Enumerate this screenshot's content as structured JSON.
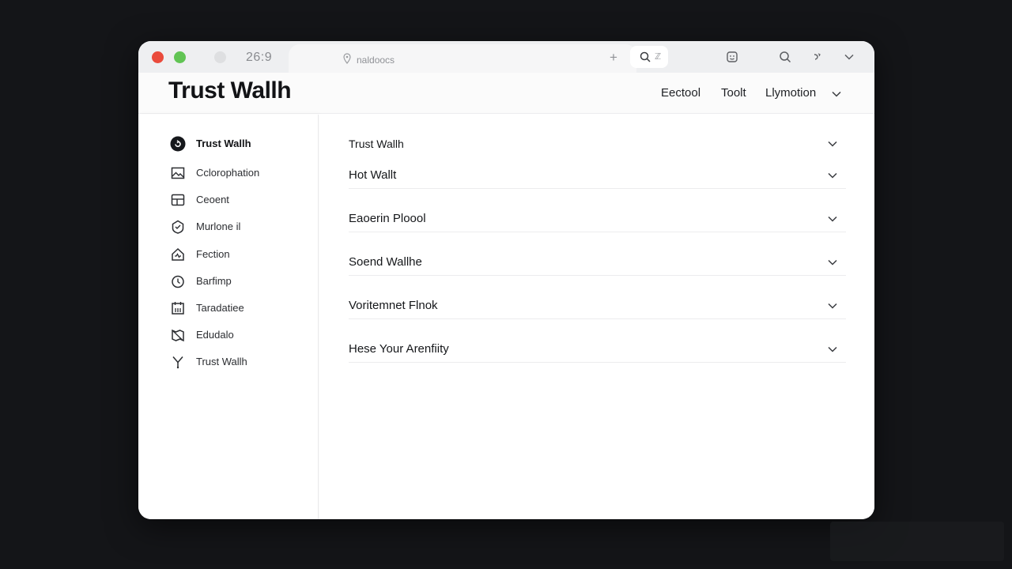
{
  "titlebar": {
    "counter": "26:9",
    "address": "naldoocs",
    "plus": "+",
    "search_hint": "ℤ"
  },
  "header": {
    "title": "Trust Wallh",
    "nav": [
      "Eectool",
      "Toolt",
      "Llymotion"
    ]
  },
  "sidebar": {
    "items": [
      {
        "label": "Trust Wallh",
        "icon": "wallet-circle-icon",
        "active": true
      },
      {
        "label": "Cclorophation",
        "icon": "image-icon"
      },
      {
        "label": "Ceoent",
        "icon": "layout-icon"
      },
      {
        "label": "Murlone il",
        "icon": "shield-check-icon"
      },
      {
        "label": "Fection",
        "icon": "home-pulse-icon"
      },
      {
        "label": "Barfimp",
        "icon": "clock-icon"
      },
      {
        "label": "Taradatiee",
        "icon": "calendar-icon"
      },
      {
        "label": "Edudalo",
        "icon": "map-icon"
      },
      {
        "label": "Trust Wallh",
        "icon": "fork-icon"
      }
    ]
  },
  "main": {
    "rows": [
      {
        "label": "Trust Wallh"
      },
      {
        "label": "Hot Wallt"
      },
      {
        "label": "Eaoerin Ploool"
      },
      {
        "label": "Soend Wallhe"
      },
      {
        "label": "Voritemnet Flnok"
      },
      {
        "label": "Hese Your Arenfiity"
      }
    ]
  },
  "colors": {
    "accent_dark": "#121316",
    "traffic_red": "#ea4b3c",
    "traffic_green": "#61c454"
  }
}
